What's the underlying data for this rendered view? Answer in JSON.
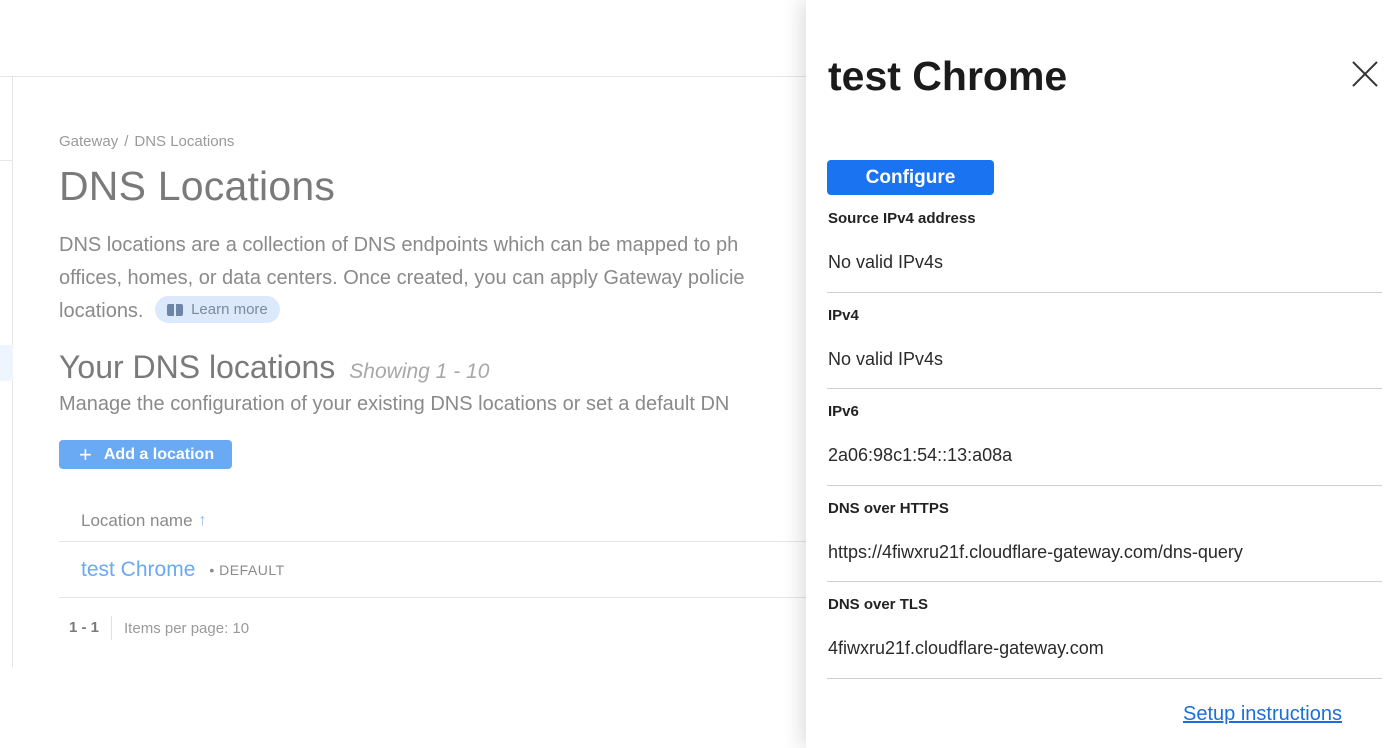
{
  "breadcrumb": {
    "parent": "Gateway",
    "separator": "/",
    "current": "DNS Locations"
  },
  "page": {
    "title": "DNS Locations",
    "description": "DNS locations are a collection of DNS endpoints which can be mapped to ph offices, homes, or data centers. Once created, you can apply Gateway policies locations.",
    "description_line1": "DNS locations are a collection of DNS endpoints which can be mapped to ph",
    "description_line2": "offices, homes, or data centers. Once created, you can apply Gateway policie",
    "description_line3": "locations.",
    "learn_more": "Learn more"
  },
  "locations_section": {
    "title": "Your DNS locations",
    "showing": "Showing 1 - 10",
    "description": "Manage the configuration of your existing DNS locations or set a default DN",
    "add_button": "Add a location"
  },
  "table": {
    "column_header": "Location name",
    "sort_icon": "↑",
    "rows": [
      {
        "name": "test Chrome",
        "badge": "• DEFAULT"
      }
    ],
    "pager": {
      "range": "1 - 1",
      "items_per_page": "Items per page: 10"
    }
  },
  "panel": {
    "title": "test Chrome",
    "configure_button": "Configure",
    "fields": [
      {
        "label": "Source IPv4 address",
        "value": "No valid IPv4s"
      },
      {
        "label": "IPv4",
        "value": "No valid IPv4s"
      },
      {
        "label": "IPv6",
        "value": "2a06:98c1:54::13:a08a"
      },
      {
        "label": "DNS over HTTPS",
        "value": "https://4fiwxru21f.cloudflare-gateway.com/dns-query"
      },
      {
        "label": "DNS over TLS",
        "value": "4fiwxru21f.cloudflare-gateway.com"
      }
    ],
    "setup_link": "Setup instructions"
  },
  "colors": {
    "accent": "#1a73f0",
    "link": "#1a6fd8",
    "muted_accent": "#6aa9f4"
  }
}
